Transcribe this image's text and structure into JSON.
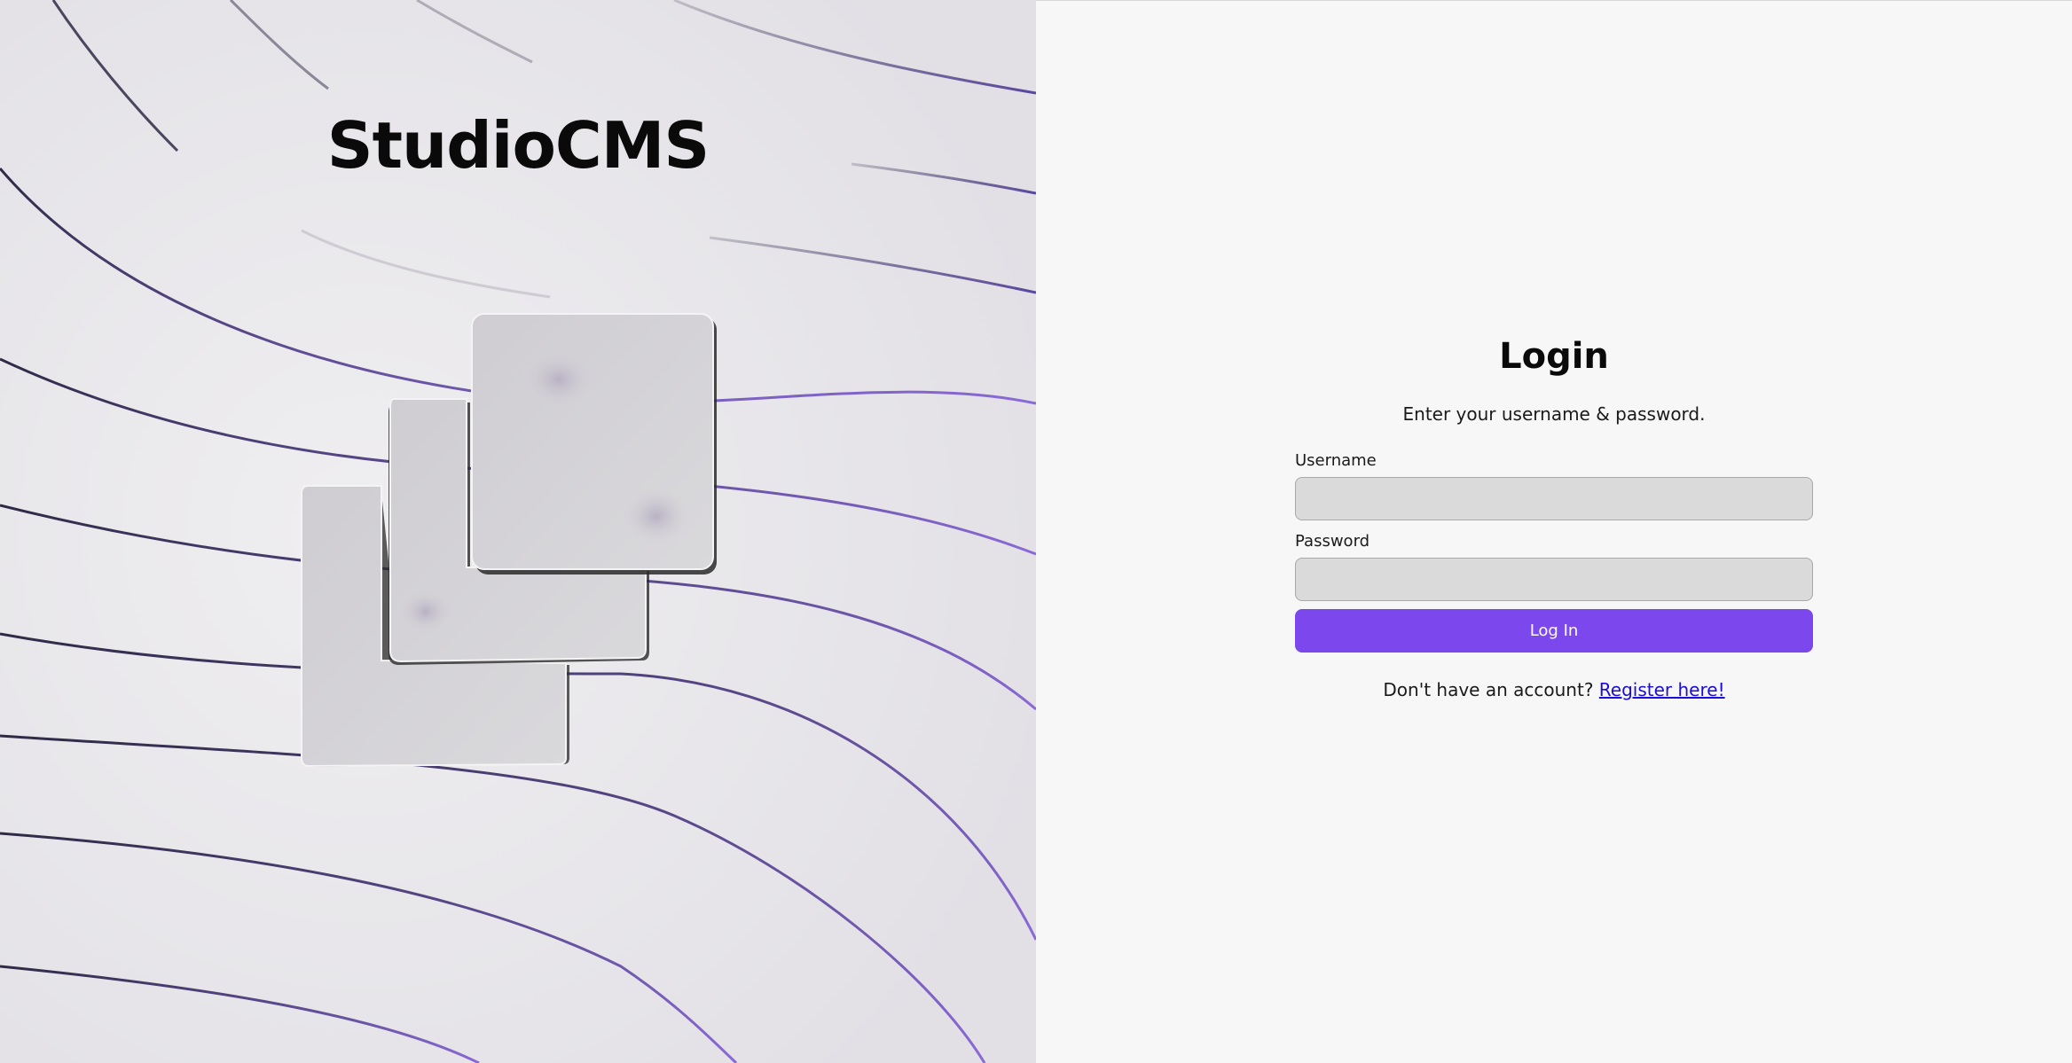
{
  "brand": {
    "name": "StudioCMS"
  },
  "login": {
    "title": "Login",
    "subtitle": "Enter your username & password.",
    "username_label": "Username",
    "username_value": "",
    "password_label": "Password",
    "password_value": "",
    "submit_label": "Log In",
    "register_prompt": "Don't have an account?",
    "register_link": "Register here!"
  },
  "colors": {
    "accent": "#7c48ee",
    "link": "#1a0ddb",
    "line_dark": "#3a3556",
    "line_purple": "#7a5bc8"
  },
  "icons": {
    "logo": "studiocms-stacked-squares-logo"
  }
}
